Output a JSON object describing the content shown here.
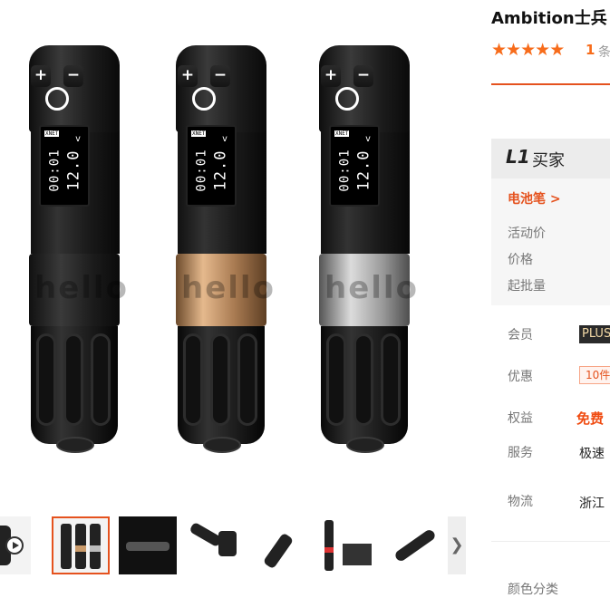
{
  "product": {
    "title": "Ambition士兵",
    "rating_stars": 5,
    "review_count": "1",
    "review_suffix": "条"
  },
  "gallery": {
    "pens": [
      {
        "screen_tag": "XNET",
        "line1": "00:01",
        "line2": "12.0",
        "unit": "v",
        "ring_color": "black",
        "ring_text": "hello"
      },
      {
        "screen_tag": "XNET",
        "line1": "00:01",
        "line2": "12.0",
        "unit": "v",
        "ring_color": "gold",
        "ring_text": "hello"
      },
      {
        "screen_tag": "XNET",
        "line1": "00:01",
        "line2": "12.0",
        "unit": "v",
        "ring_color": "silver",
        "ring_text": "hello"
      }
    ],
    "thumbnail_count": 8,
    "active_thumbnail": 1,
    "next_icon": "chevron-right-icon"
  },
  "price_panel": {
    "tier": "L1",
    "tier_label": "买家",
    "category_link": "电池笔 >",
    "rows": [
      "活动价",
      "价格",
      "起批量"
    ]
  },
  "info": {
    "member_label": "会员",
    "member_badge": "PLUS",
    "discount_label": "优惠",
    "discount_badge": "10件",
    "benefit_label": "权益",
    "benefit_value": "免费",
    "service_label": "服务",
    "service_value": "极速",
    "shipping_label": "物流",
    "shipping_value": "浙江",
    "more_label": "颜色分类"
  },
  "colors": {
    "accent": "#e5521e",
    "star": "#f76c1b"
  }
}
